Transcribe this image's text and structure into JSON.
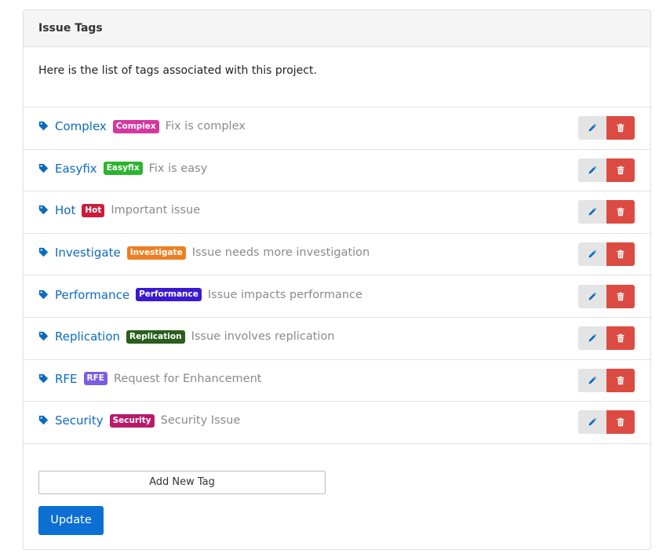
{
  "header": {
    "title": "Issue Tags"
  },
  "intro": {
    "text": "Here is the list of tags associated with this project."
  },
  "tags": [
    {
      "name": "Complex",
      "badge": "Complex",
      "color": "#d6369f",
      "description": "Fix is complex"
    },
    {
      "name": "Easyfix",
      "badge": "Easyfix",
      "color": "#2bb52f",
      "description": "Fix is easy"
    },
    {
      "name": "Hot",
      "badge": "Hot",
      "color": "#cf1b3a",
      "description": "Important issue"
    },
    {
      "name": "Investigate",
      "badge": "Investigate",
      "color": "#ec7f22",
      "description": "Issue needs more investigation"
    },
    {
      "name": "Performance",
      "badge": "Performance",
      "color": "#3a1ad1",
      "description": "Issue impacts performance"
    },
    {
      "name": "Replication",
      "badge": "Replication",
      "color": "#2a5e1d",
      "description": "Issue involves replication"
    },
    {
      "name": "RFE",
      "badge": "RFE",
      "color": "#7b5de0",
      "description": "Request for Enhancement"
    },
    {
      "name": "Security",
      "badge": "Security",
      "color": "#b8196a",
      "description": "Security Issue"
    }
  ],
  "icons": {
    "tag": "tag-icon",
    "edit": "pencil-icon",
    "delete": "trash-icon"
  },
  "colors": {
    "link": "#0c6bbf",
    "tag_icon": "#0c6bbf",
    "delete": "#dc4b42",
    "primary": "#0b6fd3"
  },
  "footer": {
    "add_label": "Add New Tag",
    "update_label": "Update"
  }
}
